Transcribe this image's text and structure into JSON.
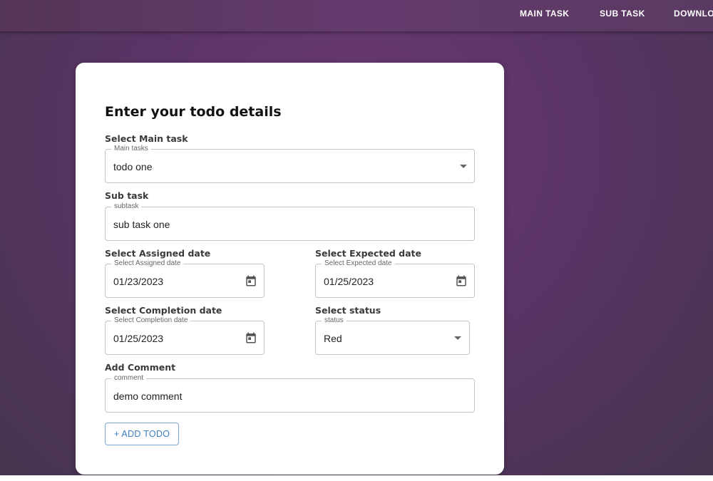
{
  "nav": {
    "items": [
      {
        "label": "MAIN TASK"
      },
      {
        "label": "SUB TASK"
      },
      {
        "label": "DOWNLO"
      }
    ]
  },
  "form": {
    "title": "Enter your todo details",
    "main_task": {
      "section_label": "Select Main task",
      "field_label": "Main tasks",
      "value": "todo one"
    },
    "sub_task": {
      "section_label": "Sub task",
      "field_label": "subtask",
      "value": "sub task one"
    },
    "assigned_date": {
      "section_label": "Select Assigned date",
      "field_label": "Select Assigned date",
      "value": "01/23/2023"
    },
    "expected_date": {
      "section_label": "Select Expected date",
      "field_label": "Select Expected date",
      "value": "01/25/2023"
    },
    "completion_date": {
      "section_label": "Select Completion date",
      "field_label": "Select Completion date",
      "value": "01/25/2023"
    },
    "status": {
      "section_label": "Select status",
      "field_label": "status",
      "value": "Red"
    },
    "comment": {
      "section_label": "Add Comment",
      "field_label": "comment",
      "value": "demo comment"
    },
    "add_button_label": "+ ADD TODO"
  },
  "icons": {
    "calendar": "calendar-icon",
    "dropdown": "chevron-down-icon"
  },
  "colors": {
    "background": "#5a3466",
    "button_accent": "#3d7fc4"
  }
}
